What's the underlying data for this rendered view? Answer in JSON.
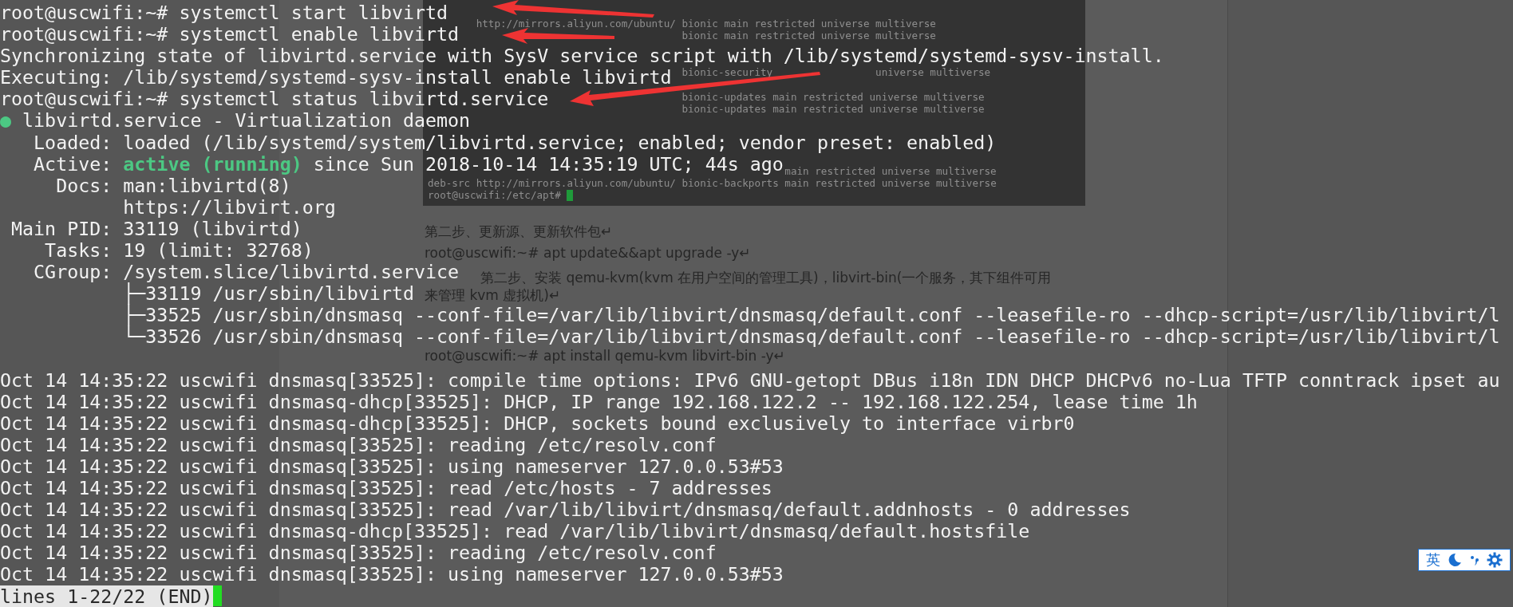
{
  "background_document": {
    "screenshot": {
      "sources": [
        {
          "url": "http://mirrors.aliyun.com/ubuntu/",
          "suite": "bionic",
          "components": "main restricted universe multiverse"
        },
        {
          "suite": "bionic",
          "components": "main restricted universe multiverse"
        },
        {
          "suite": "bionic-security",
          "components": "universe multiverse"
        },
        {
          "suite": "bionic-updates",
          "components": "main restricted universe multiverse"
        },
        {
          "suite": "bionic-updates",
          "components": "main restricted universe multiverse"
        },
        {
          "components": "main restricted universe multiverse"
        },
        {
          "archive_type": "deb-src",
          "url": "http://mirrors.aliyun.com/ubuntu/",
          "suite": "bionic-backports",
          "components": "main restricted universe multiverse"
        }
      ],
      "prompt": "root@uscwifi:/etc/apt#"
    },
    "paragraphs": [
      "第二步、更新源、更新软件包↵",
      "root@uscwifi:~# apt update&&apt upgrade -y↵",
      "第二步、安装 qemu-kvm(kvm 在用户空间的管理工具)，libvirt-bin(一个服务，其下组件可用",
      "来管理 kvm 虚拟机)↵",
      "root@uscwifi:~# apt install qemu-kvm libvirt-bin -y↵"
    ]
  },
  "terminal": {
    "lines": [
      {
        "segments": [
          {
            "kind": "plain",
            "text": "root@uscwifi:~# systemctl start libvirtd"
          }
        ]
      },
      {
        "segments": [
          {
            "kind": "plain",
            "text": "root@uscwifi:~# systemctl enable libvirtd"
          }
        ]
      },
      {
        "segments": [
          {
            "kind": "plain",
            "text": "Synchronizing state of libvirtd.service with SysV service script with /lib/systemd/systemd-sysv-install."
          }
        ]
      },
      {
        "segments": [
          {
            "kind": "plain",
            "text": "Executing: /lib/systemd/systemd-sysv-install enable libvirtd"
          }
        ]
      },
      {
        "segments": [
          {
            "kind": "plain",
            "text": "root@uscwifi:~# systemctl status libvirtd.service"
          }
        ]
      },
      {
        "segments": [
          {
            "kind": "dot",
            "text": "●"
          },
          {
            "kind": "plain",
            "text": " libvirtd.service - Virtualization daemon"
          }
        ]
      },
      {
        "segments": [
          {
            "kind": "plain",
            "text": "   Loaded: loaded (/lib/systemd/system/libvirtd.service; enabled; vendor preset: enabled)"
          }
        ]
      },
      {
        "segments": [
          {
            "kind": "plain",
            "text": "   Active: "
          },
          {
            "kind": "running",
            "text": "active (running)"
          },
          {
            "kind": "plain",
            "text": " since Sun 2018-10-14 14:35:19 UTC; 44s ago"
          }
        ]
      },
      {
        "segments": [
          {
            "kind": "plain",
            "text": "     Docs: man:libvirtd(8)"
          }
        ]
      },
      {
        "segments": [
          {
            "kind": "plain",
            "text": "           https://libvirt.org"
          }
        ]
      },
      {
        "segments": [
          {
            "kind": "plain",
            "text": " Main PID: 33119 (libvirtd)"
          }
        ]
      },
      {
        "segments": [
          {
            "kind": "plain",
            "text": "    Tasks: 19 (limit: 32768)"
          }
        ]
      },
      {
        "segments": [
          {
            "kind": "plain",
            "text": "   CGroup: /system.slice/libvirtd.service"
          }
        ]
      },
      {
        "segments": [
          {
            "kind": "plain",
            "text": "           ├─33119 /usr/sbin/libvirtd"
          }
        ]
      },
      {
        "segments": [
          {
            "kind": "plain",
            "text": "           ├─33525 /usr/sbin/dnsmasq --conf-file=/var/lib/libvirt/dnsmasq/default.conf --leasefile-ro --dhcp-script=/usr/lib/libvirt/l"
          }
        ]
      },
      {
        "segments": [
          {
            "kind": "plain",
            "text": "           └─33526 /usr/sbin/dnsmasq --conf-file=/var/lib/libvirt/dnsmasq/default.conf --leasefile-ro --dhcp-script=/usr/lib/libvirt/l"
          }
        ]
      }
    ],
    "journal_lines": [
      "Oct 14 14:35:22 uscwifi dnsmasq[33525]: compile time options: IPv6 GNU-getopt DBus i18n IDN DHCP DHCPv6 no-Lua TFTP conntrack ipset au",
      "Oct 14 14:35:22 uscwifi dnsmasq-dhcp[33525]: DHCP, IP range 192.168.122.2 -- 192.168.122.254, lease time 1h",
      "Oct 14 14:35:22 uscwifi dnsmasq-dhcp[33525]: DHCP, sockets bound exclusively to interface virbr0",
      "Oct 14 14:35:22 uscwifi dnsmasq[33525]: reading /etc/resolv.conf",
      "Oct 14 14:35:22 uscwifi dnsmasq[33525]: using nameserver 127.0.0.53#53",
      "Oct 14 14:35:22 uscwifi dnsmasq[33525]: read /etc/hosts - 7 addresses",
      "Oct 14 14:35:22 uscwifi dnsmasq[33525]: read /var/lib/libvirt/dnsmasq/default.addnhosts - 0 addresses",
      "Oct 14 14:35:22 uscwifi dnsmasq-dhcp[33525]: read /var/lib/libvirt/dnsmasq/default.hostsfile",
      "Oct 14 14:35:22 uscwifi dnsmasq[33525]: reading /etc/resolv.conf",
      "Oct 14 14:35:22 uscwifi dnsmasq[33525]: using nameserver 127.0.0.53#53"
    ],
    "pager_status": "lines 1-22/22 (END)"
  },
  "input_method_bar": {
    "mode": "英"
  }
}
